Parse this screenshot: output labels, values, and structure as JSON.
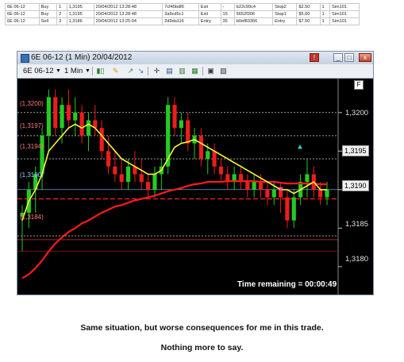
{
  "executions": [
    [
      "6E 06-12",
      "Buy",
      "1",
      "1,3195",
      "20/04/2012 13:28:48",
      "7cf45bdf6",
      "Exit",
      "-",
      "b22c99c4",
      "Stop2",
      "$2.50",
      "1",
      "Sim101"
    ],
    [
      "6E 06-12",
      "Buy",
      "2",
      "1,3195",
      "20/04/2012 13:28:48",
      "3a9cd5c1",
      "Exit",
      "15",
      "5652f306",
      "Stop1",
      "$5.00",
      "1",
      "Sim101"
    ],
    [
      "6E 06-12",
      "Sell",
      "3",
      "1,3186",
      "20/04/2012 13:25:04",
      "2d9da116",
      "Entry",
      "35",
      "b0ef83366",
      "Entry",
      "$7.50",
      "1",
      "Sim101"
    ]
  ],
  "window": {
    "title": "6E 06-12 (1 Min)  20/04/2012",
    "buttons": [
      "!",
      "_",
      "□",
      "x"
    ]
  },
  "toolbar": {
    "instrument": "6E 06-12",
    "interval": "1 Min",
    "icons": [
      "candlestick-icon",
      "pencil-icon",
      "arrow-up-icon",
      "arrow-down-icon",
      "crosshair-icon",
      "data-box-icon",
      "chart-trader-icon",
      "properties-icon",
      "zoom-icon",
      "grid-icon"
    ]
  },
  "chart": {
    "price_ticks": [
      "1,3200",
      "1,3195",
      "1,3190",
      "1,3185",
      "1,3180"
    ],
    "level_labels": [
      "(1,3200)",
      "(1,3197)",
      "(1,3194)",
      "(1,3190)",
      "(1,3184)"
    ],
    "current_price": "1,3195",
    "last_price": "1,3190",
    "panel_label": "F",
    "time_remaining": "Time remaining = 00:00:49"
  },
  "chart_data": {
    "type": "candlestick",
    "title": "6E 06-12 (1 Min) 20/04/2012",
    "y_range": [
      1.3177,
      1.3204
    ],
    "candles": [
      {
        "o": 1.31865,
        "h": 1.3188,
        "l": 1.3182,
        "c": 1.3187
      },
      {
        "o": 1.3187,
        "h": 1.3191,
        "l": 1.3185,
        "c": 1.319
      },
      {
        "o": 1.319,
        "h": 1.3193,
        "l": 1.3187,
        "c": 1.3192
      },
      {
        "o": 1.3192,
        "h": 1.3198,
        "l": 1.319,
        "c": 1.3197
      },
      {
        "o": 1.3197,
        "h": 1.3203,
        "l": 1.3195,
        "c": 1.3202
      },
      {
        "o": 1.3202,
        "h": 1.3203,
        "l": 1.3197,
        "c": 1.3198
      },
      {
        "o": 1.3198,
        "h": 1.3202,
        "l": 1.3196,
        "c": 1.3201
      },
      {
        "o": 1.3201,
        "h": 1.3203,
        "l": 1.3198,
        "c": 1.3199
      },
      {
        "o": 1.3199,
        "h": 1.3202,
        "l": 1.3197,
        "c": 1.32
      },
      {
        "o": 1.32,
        "h": 1.3201,
        "l": 1.3196,
        "c": 1.3197
      },
      {
        "o": 1.3197,
        "h": 1.32,
        "l": 1.3195,
        "c": 1.3199
      },
      {
        "o": 1.3199,
        "h": 1.3201,
        "l": 1.3197,
        "c": 1.3198
      },
      {
        "o": 1.3198,
        "h": 1.3199,
        "l": 1.3194,
        "c": 1.3195
      },
      {
        "o": 1.3195,
        "h": 1.3197,
        "l": 1.3192,
        "c": 1.3193
      },
      {
        "o": 1.3193,
        "h": 1.3195,
        "l": 1.3191,
        "c": 1.3192
      },
      {
        "o": 1.3192,
        "h": 1.3194,
        "l": 1.319,
        "c": 1.3191
      },
      {
        "o": 1.3191,
        "h": 1.3194,
        "l": 1.319,
        "c": 1.3193
      },
      {
        "o": 1.3193,
        "h": 1.3195,
        "l": 1.3191,
        "c": 1.3192
      },
      {
        "o": 1.3192,
        "h": 1.3194,
        "l": 1.319,
        "c": 1.3191
      },
      {
        "o": 1.3191,
        "h": 1.3192,
        "l": 1.3189,
        "c": 1.319
      },
      {
        "o": 1.319,
        "h": 1.3193,
        "l": 1.3189,
        "c": 1.3192
      },
      {
        "o": 1.3192,
        "h": 1.3194,
        "l": 1.319,
        "c": 1.3193
      },
      {
        "o": 1.3193,
        "h": 1.3202,
        "l": 1.3192,
        "c": 1.3201
      },
      {
        "o": 1.3201,
        "h": 1.3202,
        "l": 1.3197,
        "c": 1.3198
      },
      {
        "o": 1.3198,
        "h": 1.32,
        "l": 1.3196,
        "c": 1.3199
      },
      {
        "o": 1.3199,
        "h": 1.32,
        "l": 1.3195,
        "c": 1.3196
      },
      {
        "o": 1.3196,
        "h": 1.3198,
        "l": 1.3194,
        "c": 1.3197
      },
      {
        "o": 1.3197,
        "h": 1.3198,
        "l": 1.3193,
        "c": 1.3194
      },
      {
        "o": 1.3194,
        "h": 1.3196,
        "l": 1.3192,
        "c": 1.3195
      },
      {
        "o": 1.3195,
        "h": 1.3196,
        "l": 1.3192,
        "c": 1.3193
      },
      {
        "o": 1.3193,
        "h": 1.3194,
        "l": 1.3191,
        "c": 1.3192
      },
      {
        "o": 1.3192,
        "h": 1.3193,
        "l": 1.319,
        "c": 1.3191
      },
      {
        "o": 1.3191,
        "h": 1.3193,
        "l": 1.319,
        "c": 1.3192
      },
      {
        "o": 1.3192,
        "h": 1.3193,
        "l": 1.319,
        "c": 1.3191
      },
      {
        "o": 1.3191,
        "h": 1.3192,
        "l": 1.3189,
        "c": 1.319
      },
      {
        "o": 1.319,
        "h": 1.3192,
        "l": 1.3189,
        "c": 1.3191
      },
      {
        "o": 1.3191,
        "h": 1.3192,
        "l": 1.3189,
        "c": 1.319
      },
      {
        "o": 1.319,
        "h": 1.3191,
        "l": 1.3188,
        "c": 1.3189
      },
      {
        "o": 1.3189,
        "h": 1.3191,
        "l": 1.3188,
        "c": 1.319
      },
      {
        "o": 1.319,
        "h": 1.3191,
        "l": 1.3187,
        "c": 1.3189
      },
      {
        "o": 1.3189,
        "h": 1.319,
        "l": 1.3185,
        "c": 1.3186
      },
      {
        "o": 1.3186,
        "h": 1.319,
        "l": 1.3185,
        "c": 1.3189
      },
      {
        "o": 1.3189,
        "h": 1.3192,
        "l": 1.3188,
        "c": 1.3191
      },
      {
        "o": 1.3191,
        "h": 1.3194,
        "l": 1.3189,
        "c": 1.3192
      },
      {
        "o": 1.3192,
        "h": 1.3193,
        "l": 1.3189,
        "c": 1.319
      },
      {
        "o": 1.319,
        "h": 1.3191,
        "l": 1.3188,
        "c": 1.3189
      },
      {
        "o": 1.3189,
        "h": 1.3191,
        "l": 1.3188,
        "c": 1.319
      }
    ],
    "ema_fast": [
      1.3186,
      1.31885,
      1.319,
      1.3192,
      1.3195,
      1.3196,
      1.3197,
      1.3198,
      1.31985,
      1.3198,
      1.31985,
      1.3198,
      1.3197,
      1.3196,
      1.3195,
      1.3194,
      1.31935,
      1.3193,
      1.31925,
      1.3192,
      1.3192,
      1.31925,
      1.3194,
      1.31955,
      1.3196,
      1.31962,
      1.31965,
      1.3196,
      1.31955,
      1.3195,
      1.31945,
      1.3194,
      1.31935,
      1.3193,
      1.31925,
      1.3192,
      1.31915,
      1.3191,
      1.31905,
      1.319,
      1.319,
      1.31895,
      1.319,
      1.31905,
      1.3191,
      1.319,
      1.319
    ],
    "ema_slow": [
      1.31785,
      1.3179,
      1.31798,
      1.31808,
      1.3182,
      1.3183,
      1.31838,
      1.31845,
      1.3185,
      1.31856,
      1.3186,
      1.31865,
      1.3187,
      1.31874,
      1.31878,
      1.3188,
      1.31883,
      1.31886,
      1.31888,
      1.3189,
      1.31892,
      1.31895,
      1.31898,
      1.319,
      1.31902,
      1.31905,
      1.31907,
      1.31908,
      1.3191,
      1.3191,
      1.3191,
      1.31911,
      1.31911,
      1.31911,
      1.31911,
      1.31911,
      1.3191,
      1.3191,
      1.3191,
      1.31909,
      1.31908,
      1.31908,
      1.31908,
      1.31908,
      1.31908,
      1.31907,
      1.31907
    ],
    "levels": [
      1.32,
      1.3197,
      1.3194,
      1.319,
      1.3184
    ],
    "extra_levels": [
      1.31888,
      1.31835,
      1.3182
    ]
  },
  "caption": {
    "line1": "Same situation, but worse consequences for me in this trade.",
    "line2": "Nothing more to say."
  }
}
